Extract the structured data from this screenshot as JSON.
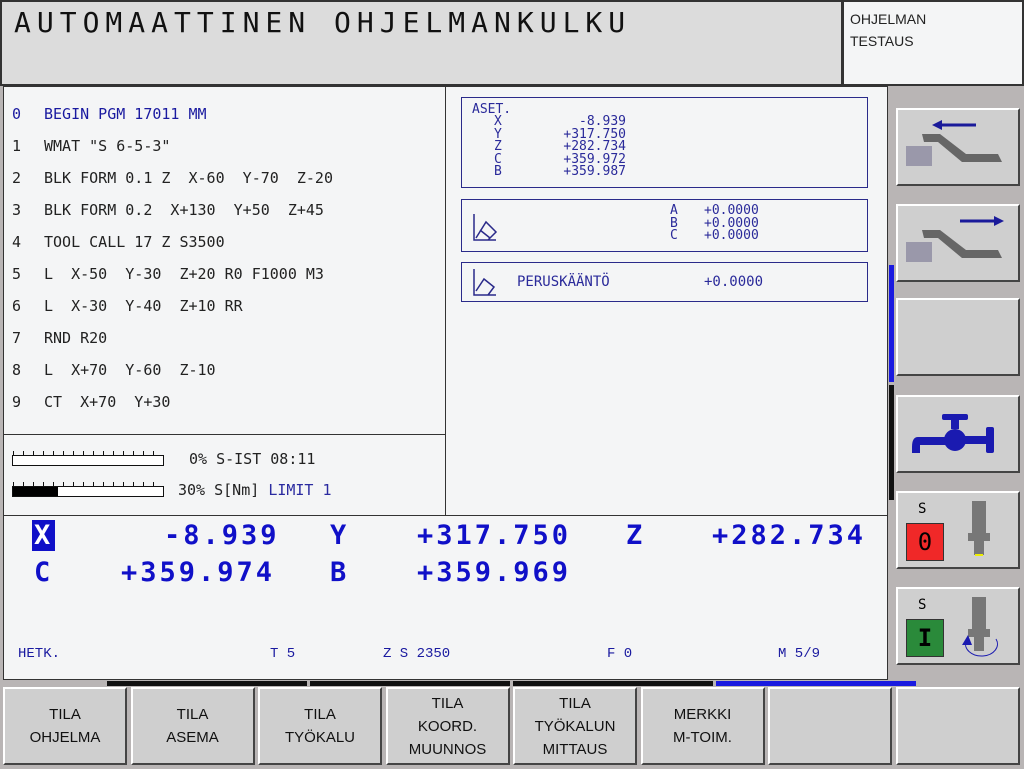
{
  "header": {
    "title": "AUTOMAATTINEN OHJELMANKULKU",
    "mode_line1": "OHJELMAN",
    "mode_line2": "TESTAUS"
  },
  "program": [
    {
      "n": "0",
      "text": "BEGIN PGM 17011 MM"
    },
    {
      "n": "1",
      "text": "WMAT \"S 6-5-3\""
    },
    {
      "n": "2",
      "text": "BLK FORM 0.1 Z  X-60  Y-70  Z-20"
    },
    {
      "n": "3",
      "text": "BLK FORM 0.2  X+130  Y+50  Z+45"
    },
    {
      "n": "4",
      "text": "TOOL CALL 17 Z S3500"
    },
    {
      "n": "5",
      "text": "L  X-50  Y-30  Z+20 R0 F1000 M3"
    },
    {
      "n": "6",
      "text": "L  X-30  Y-40  Z+10 RR"
    },
    {
      "n": "7",
      "text": "RND R20"
    },
    {
      "n": "8",
      "text": "L  X+70  Y-60  Z-10"
    },
    {
      "n": "9",
      "text": "CT  X+70  Y+30"
    }
  ],
  "status": {
    "spindle_override_pct": 0,
    "spindle_override_text": "0%",
    "s_ist_label": "S-IST",
    "s_ist_time": "08:11",
    "torque_pct": 30,
    "torque_text": "30%",
    "torque_label": "S[Nm]",
    "limit": "LIMIT 1"
  },
  "info": {
    "aset_label": "ASET.",
    "aset": [
      {
        "axis": "X",
        "value": "-8.939"
      },
      {
        "axis": "Y",
        "value": "+317.750"
      },
      {
        "axis": "Z",
        "value": "+282.734"
      },
      {
        "axis": "C",
        "value": "+359.972"
      },
      {
        "axis": "B",
        "value": "+359.987"
      }
    ],
    "rot": [
      {
        "axis": "A",
        "value": "+0.0000"
      },
      {
        "axis": "B",
        "value": "+0.0000"
      },
      {
        "axis": "C",
        "value": "+0.0000"
      }
    ],
    "basic_rotation_label": "PERUSKÄÄNTÖ",
    "basic_rotation_value": "+0.0000"
  },
  "position": {
    "axes": [
      {
        "axis": "X",
        "value": "-8.939"
      },
      {
        "axis": "Y",
        "value": "+317.750"
      },
      {
        "axis": "Z",
        "value": "+282.734"
      },
      {
        "axis": "C",
        "value": "+359.974"
      },
      {
        "axis": "B",
        "value": "+359.969"
      }
    ],
    "mode": "HETK.",
    "tool": "T 5",
    "spindle": "Z S 2350",
    "feed": "F 0",
    "mfunc": "M 5/9"
  },
  "softkeys": [
    {
      "l1": "TILA",
      "l2": "OHJELMA"
    },
    {
      "l1": "TILA",
      "l2": "ASEMA"
    },
    {
      "l1": "TILA",
      "l2": "TYÖKALU"
    },
    {
      "l1": "TILA",
      "l2": "KOORD.",
      "l3": "MUUNNOS"
    },
    {
      "l1": "TILA",
      "l2": "TYÖKALUN",
      "l3": "MITTAUS"
    },
    {
      "l1": "MERKKI",
      "l2": "M-TOIM."
    },
    {
      "l1": ""
    },
    {
      "l1": ""
    }
  ],
  "side": {
    "spindle_label": "S",
    "spindle_off": "0",
    "spindle_on": "I"
  },
  "colors": {
    "accent": "#1010c8",
    "red": "#f02828",
    "green": "#2a8a3a"
  }
}
